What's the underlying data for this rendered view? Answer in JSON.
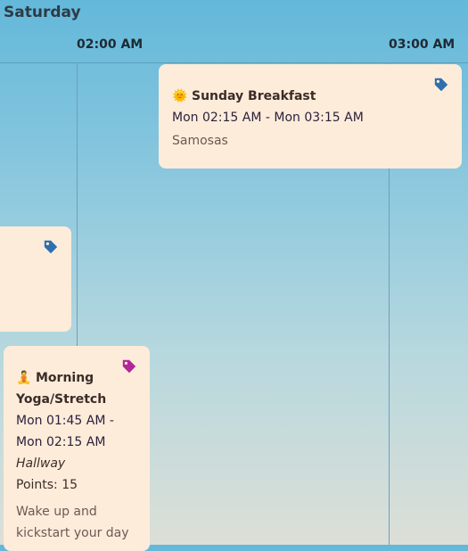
{
  "header": {
    "day": "Saturday",
    "times": [
      "02:00 AM",
      "03:00 AM"
    ]
  },
  "events": [
    {
      "icon": "sun-icon",
      "emoji": "🌞",
      "title": "Sunday Breakfast",
      "time": "Mon 02:15 AM - Mon 03:15 AM",
      "description": "Samosas",
      "tag_color": "#2f6fad"
    },
    {
      "tag_color": "#2f6fad"
    },
    {
      "icon": "yoga-person-icon",
      "emoji": "🧘",
      "title": "Morning Yoga/Stretch",
      "time": "Mon 01:45 AM - Mon 02:15 AM",
      "location": "Hallway",
      "points": "Points: 15",
      "description": "Wake up and kickstart your day",
      "tag_color": "#b2259b"
    }
  ]
}
